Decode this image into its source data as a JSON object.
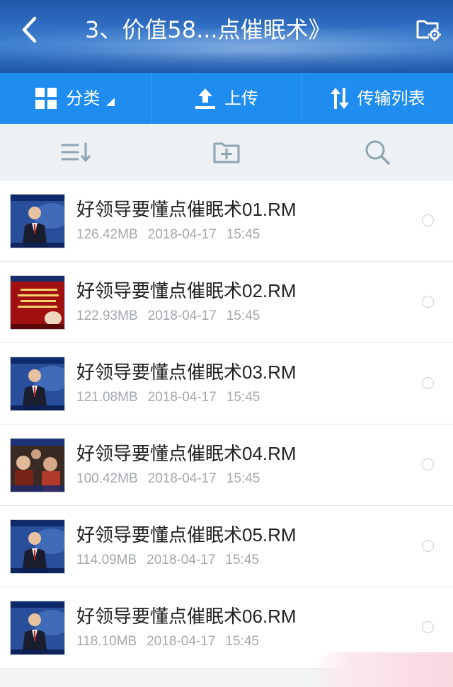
{
  "header": {
    "title": "3、价值58...点催眠术》",
    "back_icon": "chevron-left-icon",
    "right_icon": "folder-settings-icon"
  },
  "toolbar": {
    "category_label": "分类",
    "upload_label": "上传",
    "transfer_label": "传输列表"
  },
  "actionbar": {
    "icons": [
      "sort-icon",
      "new-folder-icon",
      "search-icon"
    ]
  },
  "files": [
    {
      "name": "好领导要懂点催眠术01.RM",
      "size": "126.42MB",
      "date": "2018-04-17",
      "time": "15:45",
      "thumb": "speaker"
    },
    {
      "name": "好领导要懂点催眠术02.RM",
      "size": "122.93MB",
      "date": "2018-04-17",
      "time": "15:45",
      "thumb": "red-slide"
    },
    {
      "name": "好领导要懂点催眠术03.RM",
      "size": "121.08MB",
      "date": "2018-04-17",
      "time": "15:45",
      "thumb": "speaker"
    },
    {
      "name": "好领导要懂点催眠术04.RM",
      "size": "100.42MB",
      "date": "2018-04-17",
      "time": "15:45",
      "thumb": "audience"
    },
    {
      "name": "好领导要懂点催眠术05.RM",
      "size": "114.09MB",
      "date": "2018-04-17",
      "time": "15:45",
      "thumb": "speaker"
    },
    {
      "name": "好领导要懂点催眠术06.RM",
      "size": "118.10MB",
      "date": "2018-04-17",
      "time": "15:45",
      "thumb": "speaker"
    }
  ],
  "colors": {
    "toolbar_blue": "#1f8cf0",
    "actionbar_bg": "#eef1f3",
    "icon_gray": "#8ea4b3"
  }
}
